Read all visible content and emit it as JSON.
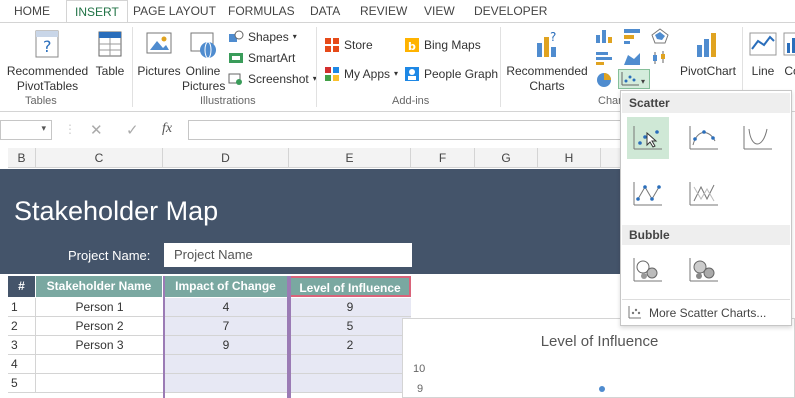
{
  "ribbon_tabs": [
    "HOME",
    "INSERT",
    "PAGE LAYOUT",
    "FORMULAS",
    "DATA",
    "REVIEW",
    "VIEW",
    "DEVELOPER"
  ],
  "active_tab": "INSERT",
  "tables_group": {
    "recommended_pivot_l1": "Recommended",
    "recommended_pivot_l2": "PivotTables",
    "table": "Table",
    "label": "Tables"
  },
  "illustrations_group": {
    "pictures": "Pictures",
    "online_l1": "Online",
    "online_l2": "Pictures",
    "shapes": "Shapes",
    "smartart": "SmartArt",
    "screenshot": "Screenshot",
    "label": "Illustrations"
  },
  "addins_group": {
    "store": "Store",
    "my_apps": "My Apps",
    "bing_maps": "Bing Maps",
    "people_graph": "People Graph",
    "label": "Add-ins"
  },
  "charts_group": {
    "recommended_l1": "Recommended",
    "recommended_l2": "Charts",
    "pivotchart": "PivotChart",
    "label_partial": "Char",
    "line": "Line",
    "col_partial": "Co"
  },
  "formula_bar": {
    "fx": "fx"
  },
  "columns": [
    "B",
    "C",
    "D",
    "E",
    "F",
    "G",
    "H"
  ],
  "sheet": {
    "title": "Stakeholder Map",
    "project_label": "Project Name:",
    "project_value": "Project Name",
    "headers": [
      "#",
      "Stakeholder Name",
      "Impact of Change",
      "Level of Influence"
    ],
    "rows": [
      {
        "n": "1",
        "name": "Person 1",
        "impact": "4",
        "influence": "9"
      },
      {
        "n": "2",
        "name": "Person 2",
        "impact": "7",
        "influence": "5"
      },
      {
        "n": "3",
        "name": "Person 3",
        "impact": "9",
        "influence": "2"
      },
      {
        "n": "4",
        "name": "",
        "impact": "",
        "influence": ""
      },
      {
        "n": "5",
        "name": "",
        "impact": "",
        "influence": ""
      }
    ]
  },
  "dropdown": {
    "scatter_label": "Scatter",
    "bubble_label": "Bubble",
    "more": "More Scatter Charts..."
  },
  "chart": {
    "title": "Level of Influence",
    "y_ticks": [
      "10",
      "9"
    ]
  },
  "colors": {
    "excel_green": "#217346",
    "banner": "#44546a",
    "header_teal": "#7aa8a1",
    "highlight": "#cfe8d6"
  }
}
